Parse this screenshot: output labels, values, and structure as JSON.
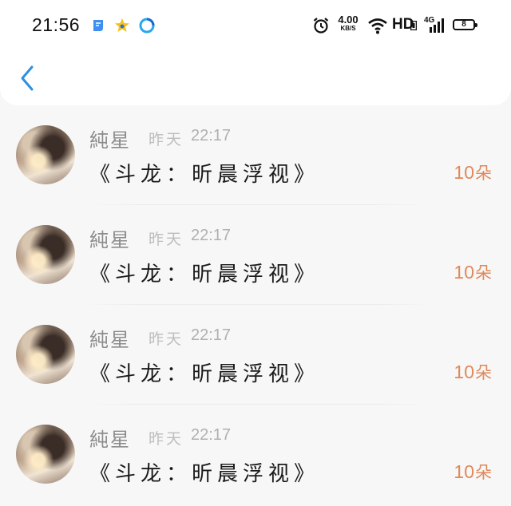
{
  "status_bar": {
    "time": "21:56",
    "net_speed_value": "4.00",
    "net_speed_unit": "KB/S",
    "network_mode": "HD",
    "signal_type": "4G",
    "battery_level": "8"
  },
  "nav": {
    "back_icon": "chevron-left-icon"
  },
  "colors": {
    "accent": "#2f8fe0",
    "amount": "#e0885a"
  },
  "gifts": [
    {
      "sender": "純星",
      "time_label": "昨天",
      "time": "22:17",
      "message": "《斗龙：昕晨浮视》",
      "amount": "10",
      "unit": "朵"
    },
    {
      "sender": "純星",
      "time_label": "昨天",
      "time": "22:17",
      "message": "《斗龙：昕晨浮视》",
      "amount": "10",
      "unit": "朵"
    },
    {
      "sender": "純星",
      "time_label": "昨天",
      "time": "22:17",
      "message": "《斗龙：昕晨浮视》",
      "amount": "10",
      "unit": "朵"
    },
    {
      "sender": "純星",
      "time_label": "昨天",
      "time": "22:17",
      "message": "《斗龙：昕晨浮视》",
      "amount": "10",
      "unit": "朵"
    }
  ]
}
